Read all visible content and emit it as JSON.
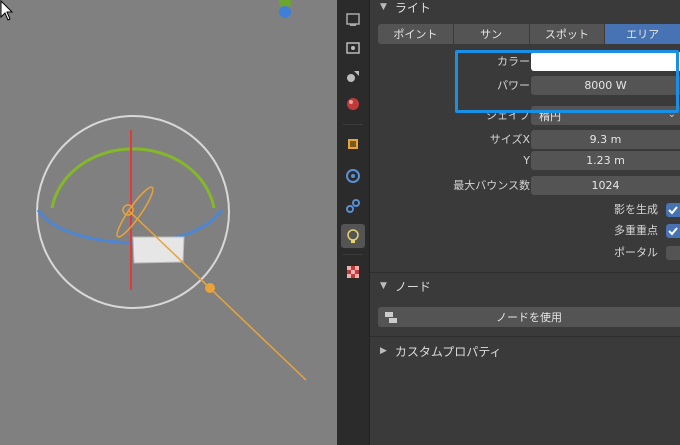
{
  "light_panel": {
    "title": "ライト",
    "type_tabs": [
      {
        "label": "ポイント",
        "active": false
      },
      {
        "label": "サン",
        "active": false
      },
      {
        "label": "スポット",
        "active": false
      },
      {
        "label": "エリア",
        "active": true
      }
    ],
    "color": {
      "label": "カラー",
      "value": "#ffffff"
    },
    "power": {
      "label": "パワー",
      "value": "8000 W"
    },
    "shape": {
      "label": "シェイプ",
      "value": "楕円"
    },
    "size_x": {
      "label": "サイズX",
      "value": "9.3 m"
    },
    "size_y": {
      "label": "Y",
      "value": "1.23 m"
    },
    "max_bounces": {
      "label": "最大バウンス数",
      "value": "1024"
    },
    "cast_shadow": {
      "label": "影を生成",
      "checked": true
    },
    "multiple_importance": {
      "label": "多重重点",
      "checked": true
    },
    "portal": {
      "label": "ポータル",
      "checked": false
    }
  },
  "node_panel": {
    "title": "ノード",
    "use_nodes_label": "ノードを使用"
  },
  "custom_props_panel": {
    "title": "カスタムプロパティ"
  },
  "icons": {
    "tabs": [
      "tool-icon",
      "render-icon",
      "output-icon",
      "view-layer-icon",
      "scene-icon",
      "world-icon",
      "object-icon",
      "modifier-icon",
      "physics-icon",
      "object-data-light-icon",
      "texture-icon"
    ]
  },
  "colors": {
    "accent": "#4772b3",
    "highlight_box": "#1a8fe6",
    "gizmo_orange": "#e8a33a",
    "gizmo_green": "#8cbf26",
    "gizmo_blue": "#4f8ad6",
    "gizmo_red": "#e03c3c"
  }
}
